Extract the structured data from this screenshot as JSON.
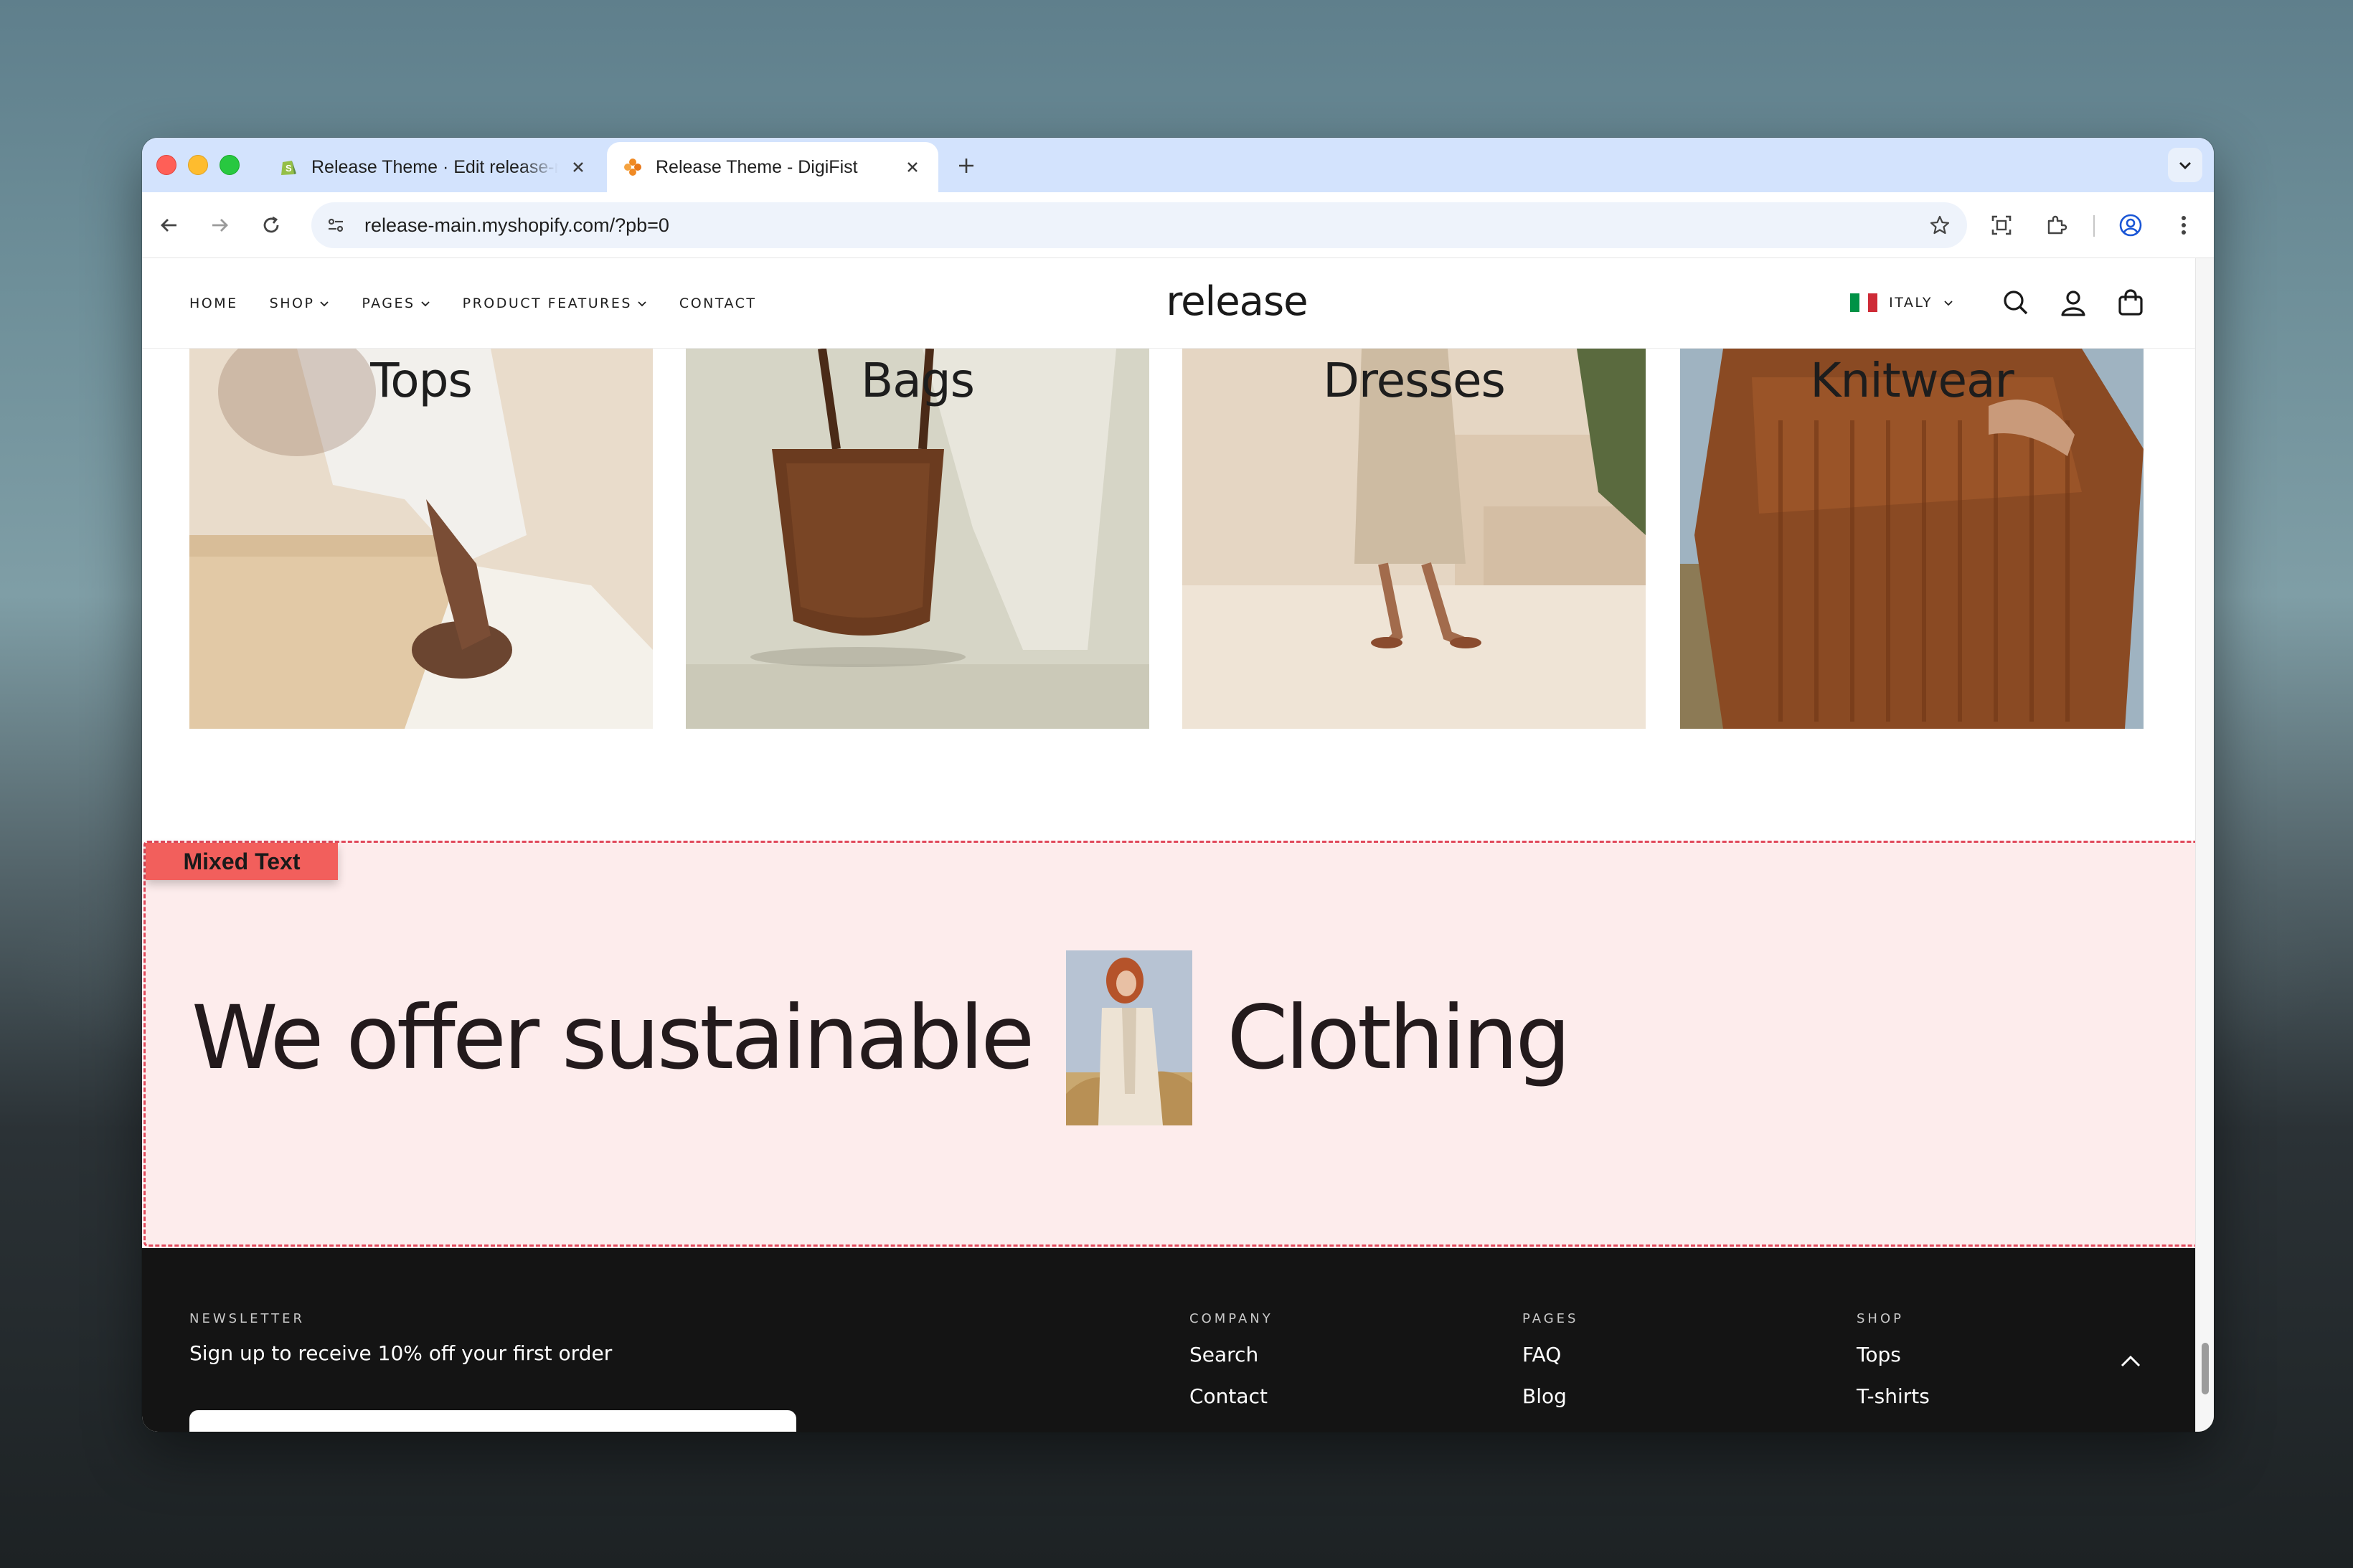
{
  "browser": {
    "tabs": [
      {
        "title": "Release Theme · Edit release-main",
        "active": false,
        "icon": "shopify-icon"
      },
      {
        "title": "Release Theme - DigiFist",
        "active": true,
        "icon": "digifist-icon"
      }
    ],
    "url": "release-main.myshopify.com/?pb=0"
  },
  "site": {
    "nav": [
      {
        "label": "HOME",
        "dropdown": false
      },
      {
        "label": "SHOP",
        "dropdown": true
      },
      {
        "label": "PAGES",
        "dropdown": true
      },
      {
        "label": "PRODUCT FEATURES",
        "dropdown": true
      },
      {
        "label": "CONTACT",
        "dropdown": false
      }
    ],
    "logo": "release",
    "country": "ITALY",
    "flag_colors": [
      "#009246",
      "#ffffff",
      "#ce2b37"
    ]
  },
  "collections": [
    {
      "label": "Tops"
    },
    {
      "label": "Bags"
    },
    {
      "label": "Dresses"
    },
    {
      "label": "Knitwear"
    }
  ],
  "mixed": {
    "badge": "Mixed Text",
    "text_before": "We offer sustainable",
    "text_after": "Clothing"
  },
  "footer": {
    "newsletter_heading": "NEWSLETTER",
    "newsletter_text": "Sign up to receive 10% off your first order",
    "columns": [
      {
        "heading": "COMPANY",
        "links": [
          "Search",
          "Contact"
        ]
      },
      {
        "heading": "PAGES",
        "links": [
          "FAQ",
          "Blog"
        ]
      },
      {
        "heading": "SHOP",
        "links": [
          "Tops",
          "T-shirts"
        ]
      }
    ]
  },
  "colors": {
    "accent_badge": "#f25f5c",
    "mixed_bg": "#fdecec",
    "footer_bg": "#141414"
  }
}
